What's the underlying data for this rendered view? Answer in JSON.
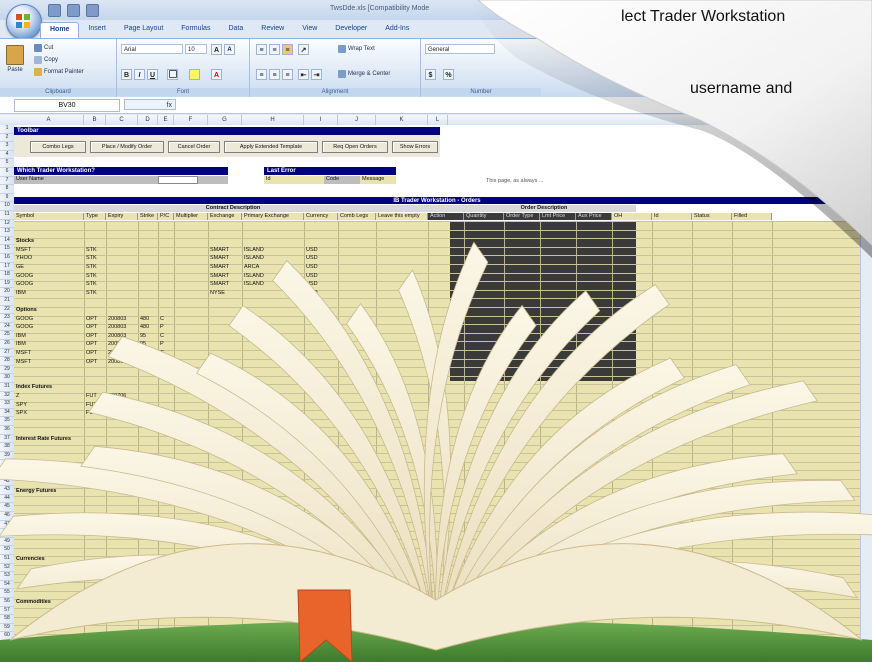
{
  "window": {
    "title": "TwsDde.xls  [Compatibility Mode"
  },
  "ribbon_tabs": [
    "Home",
    "Insert",
    "Page Layout",
    "Formulas",
    "Data",
    "Review",
    "View",
    "Developer",
    "Add-Ins"
  ],
  "clipboard": {
    "cut": "Cut",
    "copy": "Copy",
    "paste": "Paste",
    "format_painter": "Format Painter",
    "label": "Clipboard"
  },
  "font": {
    "name": "Arial",
    "size": "10",
    "bold": "B",
    "italic": "I",
    "underline": "U",
    "grow": "A",
    "shrink": "A",
    "label": "Font"
  },
  "alignment": {
    "wrap": "Wrap Text",
    "merge": "Merge & Center",
    "label": "Alignment"
  },
  "number": {
    "format": "General",
    "currency": "$",
    "percent": "%",
    "label": "Number"
  },
  "formula_bar": {
    "name_box": "BV30",
    "fx": "fx"
  },
  "columns": [
    "A",
    "B",
    "C",
    "D",
    "E",
    "F",
    "G",
    "H",
    "I",
    "J",
    "K",
    "L"
  ],
  "toolbar_section": {
    "title": "Toolbar",
    "buttons": [
      "Combo Legs",
      "Place / Modify Order",
      "Cancel Order",
      "Apply Extended Template",
      "Req Open Orders",
      "Show Errors"
    ]
  },
  "tws_section": {
    "title": "Which Trader Workstation?",
    "user_label": "User Name"
  },
  "error_section": {
    "title": "Last Error",
    "id_label": "Id",
    "code_label": "Code",
    "message_label": "Message"
  },
  "page_note": "This page, as always ...",
  "orders_title": "IB Trader Workstation - Orders",
  "contract_desc": "Contract Description",
  "order_desc": "Order Description",
  "headers": [
    "Symbol",
    "Type",
    "Expiry",
    "Strike",
    "P/C",
    "Multiplier",
    "Exchange",
    "Primary Exchange",
    "Currency",
    "Comb Legs",
    "Leave this empty",
    "Action",
    "Quantity",
    "Order Type",
    "Lmt Price",
    "Aux Price",
    "OH",
    "Id",
    "Status",
    "Filled"
  ],
  "row_labels": [
    "Stocks",
    "Options",
    "Index Futures",
    "Interest Rate Futures",
    "Energy Futures",
    "Future Options",
    "Currencies",
    "Commodities"
  ],
  "stocks": [
    [
      "MSFT",
      "STK",
      "",
      "",
      "",
      "",
      "SMART",
      "ISLAND",
      "USD"
    ],
    [
      "YHOO",
      "STK",
      "",
      "",
      "",
      "",
      "SMART",
      "ISLAND",
      "USD"
    ],
    [
      "GE",
      "STK",
      "",
      "",
      "",
      "",
      "SMART",
      "ARCA",
      "USD"
    ],
    [
      "GOOG",
      "STK",
      "",
      "",
      "",
      "",
      "SMART",
      "ISLAND",
      "USD"
    ],
    [
      "GOOG",
      "STK",
      "",
      "",
      "",
      "",
      "SMART",
      "ISLAND",
      "USD"
    ],
    [
      "IBM",
      "STK",
      "",
      "",
      "",
      "",
      "NYSE",
      "",
      "USD"
    ]
  ],
  "options": [
    [
      "GOOG",
      "OPT",
      "200803",
      "480",
      "C"
    ],
    [
      "GOOG",
      "OPT",
      "200803",
      "480",
      "P"
    ],
    [
      "IBM",
      "OPT",
      "200803",
      "95",
      "C"
    ],
    [
      "IBM",
      "OPT",
      "200803",
      "95",
      "P"
    ],
    [
      "MSFT",
      "OPT",
      "200803",
      "27.5",
      "C"
    ],
    [
      "MSFT",
      "OPT",
      "200803",
      "27.5",
      "P"
    ]
  ],
  "futures": [
    [
      "Z",
      "FUT",
      "200706"
    ],
    [
      "SPY",
      "FUT",
      "200803"
    ],
    [
      "SPX",
      "FUT",
      "200803"
    ]
  ],
  "curl_page": {
    "line1": "lect Trader Workstation",
    "line2": "username and"
  },
  "colors": {
    "navy": "#000080",
    "tan": "#e9e3b0",
    "dark": "#3a3a3a",
    "ribbon": "#dae6f5",
    "bookmark": "#e8642a",
    "cover": "#4c8a3a"
  }
}
